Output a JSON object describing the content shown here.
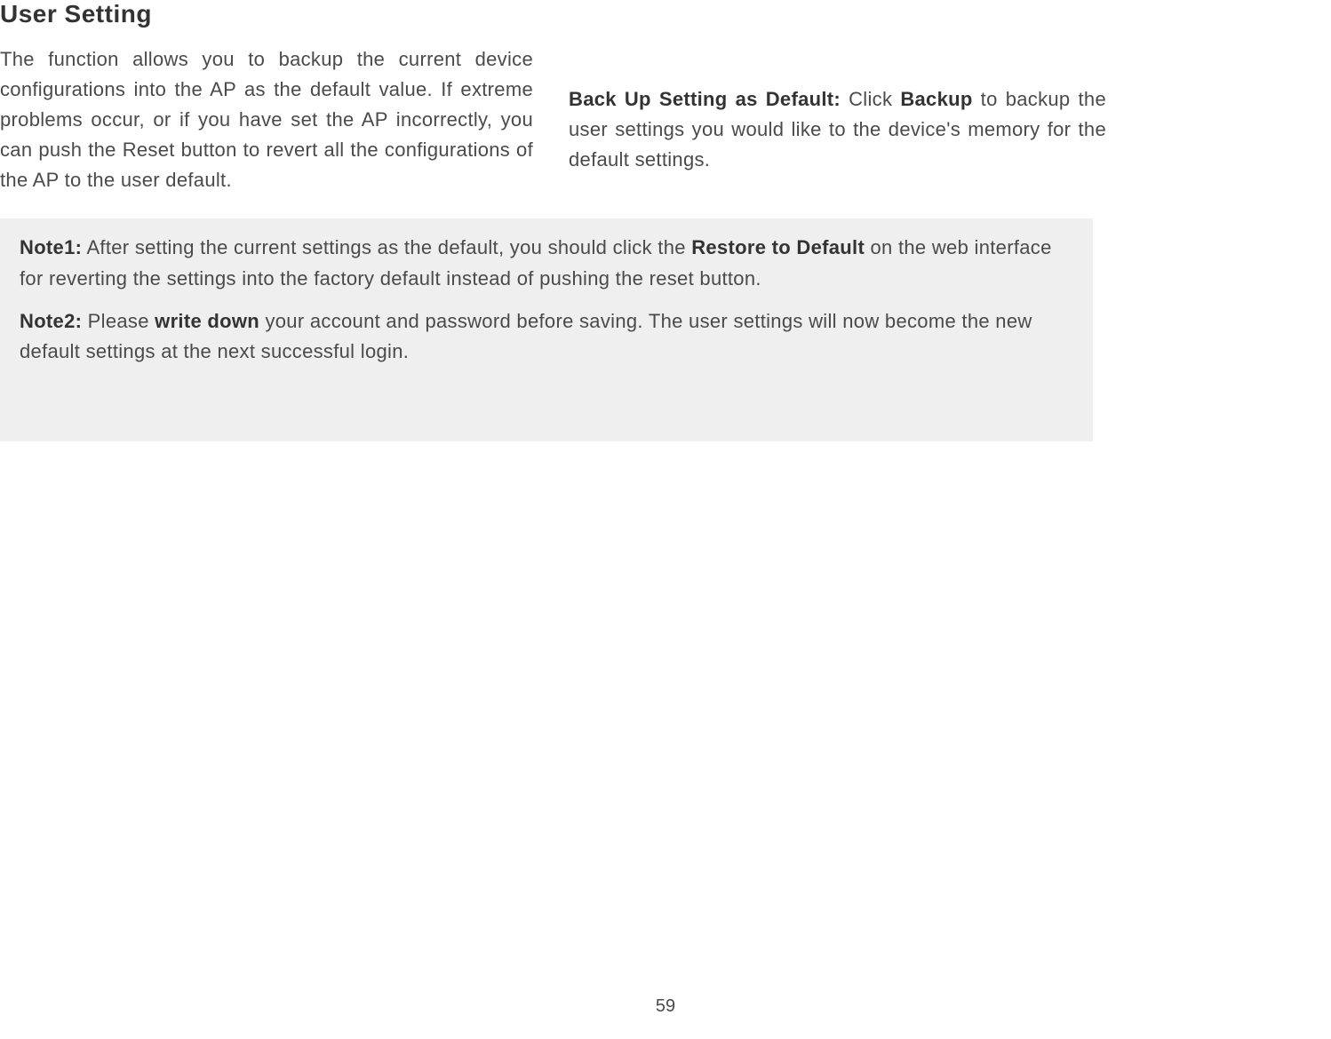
{
  "title": "User Setting",
  "leftColumn": {
    "text": "The function allows you to backup the current device configurations into the AP as the default value. If extreme problems occur, or if you have set the AP incorrectly, you can push the Reset button to revert all the configurations of the AP to the user default."
  },
  "rightColumn": {
    "label": "Back Up Setting as Default:",
    "textPrefix": "  Click ",
    "boldWord": "Backup",
    "textSuffix": " to backup the user settings you would like to the device's memory for the default settings."
  },
  "notes": {
    "note1": {
      "label": "Note1:",
      "textPrefix": " After setting the current settings as the default, you should click the ",
      "boldPhrase": "Restore to Default",
      "textSuffix": " on the web interface for reverting the settings into the factory default instead of pushing the reset button."
    },
    "note2": {
      "label": "Note2:",
      "textPrefix": " Please ",
      "boldPhrase": "write down",
      "textSuffix": " your account and password before saving. The user settings will now become the new default settings at the next successful login."
    }
  },
  "pageNumber": "59"
}
